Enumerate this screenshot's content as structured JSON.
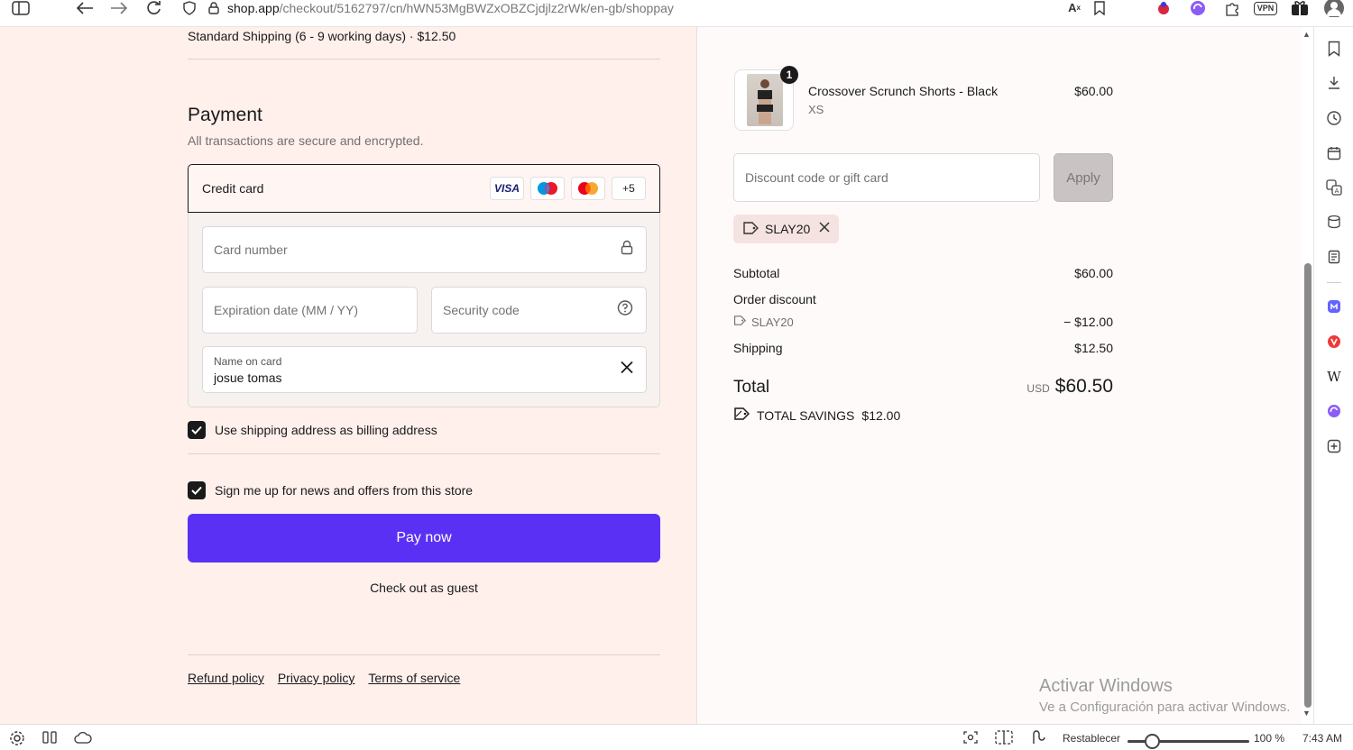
{
  "browser": {
    "url_host": "shop.app",
    "url_path": "/checkout/5162797/cn/hWN53MgBWZxOBZCjdjlz2rWk/en-gb/shoppay",
    "icons": [
      "sidebar-toggle-icon",
      "back-icon",
      "forward-icon",
      "reload-icon",
      "shield-icon",
      "lock-icon",
      "translate-icon",
      "bookmark-icon",
      "extension-ladybug-icon",
      "extension-purple-icon",
      "extensions-puzzle-icon",
      "vpn-icon",
      "gift-icon",
      "profile-icon"
    ],
    "vpn_label": "VPN"
  },
  "shipping": {
    "line": "Standard Shipping (6 - 9 working days) · $12.50"
  },
  "payment": {
    "title": "Payment",
    "subtitle": "All transactions are secure and encrypted.",
    "method_label": "Credit card",
    "card_brands": [
      "VISA",
      "maestro",
      "mastercard"
    ],
    "more_brands": "+5",
    "card_number_placeholder": "Card number",
    "expiry_placeholder": "Expiration date (MM / YY)",
    "security_placeholder": "Security code",
    "name_label": "Name on card",
    "name_value": "josue tomas",
    "billing_checkbox_label": "Use shipping address as billing address",
    "billing_checked": true,
    "newsletter_checkbox_label": "Sign me up for news and offers from this store",
    "newsletter_checked": true,
    "pay_button": "Pay now",
    "guest_link": "Check out as guest",
    "accent_color": "#5a31f4"
  },
  "footer": {
    "refund": "Refund policy",
    "privacy": "Privacy policy",
    "terms": "Terms of service"
  },
  "order": {
    "item": {
      "name": "Crossover Scrunch Shorts - Black",
      "variant": "XS",
      "price": "$60.00",
      "quantity": "1"
    },
    "discount_placeholder": "Discount code or gift card",
    "apply_button": "Apply",
    "applied_code": "SLAY20",
    "subtotal_label": "Subtotal",
    "subtotal_value": "$60.00",
    "order_discount_label": "Order discount",
    "discount_code": "SLAY20",
    "discount_value": "− $12.00",
    "shipping_label": "Shipping",
    "shipping_value": "$12.50",
    "total_label": "Total",
    "currency": "USD",
    "total_value": "$60.50",
    "savings_label": "TOTAL SAVINGS",
    "savings_value": "$12.00"
  },
  "watermark": {
    "line1": "Activar Windows",
    "line2": "Ve a Configuración para activar Windows."
  },
  "statusbar": {
    "reset_label": "Restablecer",
    "zoom": "100 %",
    "zoom_level": 1.0,
    "time": "7:43 AM"
  }
}
